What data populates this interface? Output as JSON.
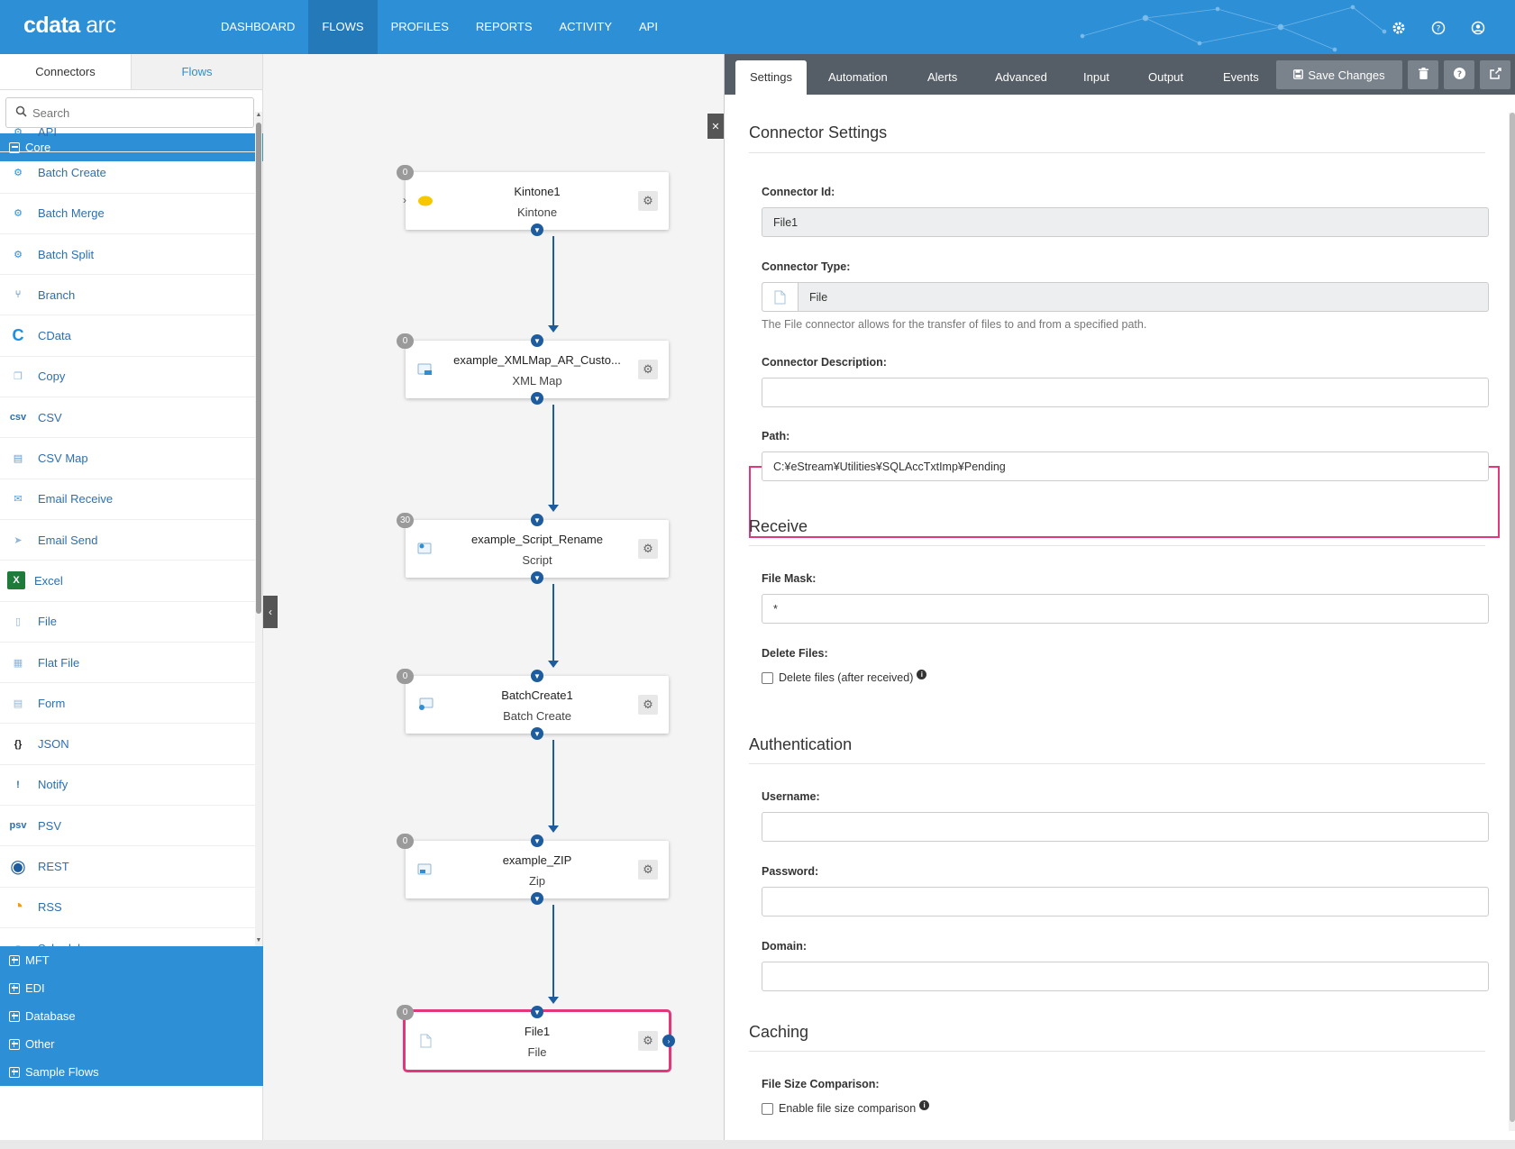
{
  "app": {
    "logo_brand": "cdata",
    "logo_product": "arc"
  },
  "nav": {
    "items": [
      {
        "label": "DASHBOARD",
        "active": false
      },
      {
        "label": "FLOWS",
        "active": true
      },
      {
        "label": "PROFILES",
        "active": false
      },
      {
        "label": "REPORTS",
        "active": false
      },
      {
        "label": "ACTIVITY",
        "active": false
      },
      {
        "label": "API",
        "active": false
      }
    ],
    "icons": [
      "gear-icon",
      "help-icon",
      "user-icon"
    ]
  },
  "left": {
    "tabs": [
      "Connectors",
      "Flows"
    ],
    "search_placeholder": "Search",
    "core_group": "Core",
    "connectors": [
      {
        "label": "API",
        "icon": "api-icon"
      },
      {
        "label": "Batch Create",
        "icon": "batch-create-icon"
      },
      {
        "label": "Batch Merge",
        "icon": "batch-merge-icon"
      },
      {
        "label": "Batch Split",
        "icon": "batch-split-icon"
      },
      {
        "label": "Branch",
        "icon": "branch-icon"
      },
      {
        "label": "CData",
        "icon": "cdata-icon"
      },
      {
        "label": "Copy",
        "icon": "copy-icon"
      },
      {
        "label": "CSV",
        "icon": "csv-icon"
      },
      {
        "label": "CSV Map",
        "icon": "csv-map-icon"
      },
      {
        "label": "Email Receive",
        "icon": "email-receive-icon"
      },
      {
        "label": "Email Send",
        "icon": "email-send-icon"
      },
      {
        "label": "Excel",
        "icon": "excel-icon"
      },
      {
        "label": "File",
        "icon": "file-icon"
      },
      {
        "label": "Flat File",
        "icon": "flat-file-icon"
      },
      {
        "label": "Form",
        "icon": "form-icon"
      },
      {
        "label": "JSON",
        "icon": "json-icon"
      },
      {
        "label": "Notify",
        "icon": "notify-icon"
      },
      {
        "label": "PSV",
        "icon": "psv-icon"
      },
      {
        "label": "REST",
        "icon": "rest-icon"
      },
      {
        "label": "RSS",
        "icon": "rss-icon"
      },
      {
        "label": "Schedule",
        "icon": "schedule-icon"
      }
    ],
    "groups": [
      "MFT",
      "EDI",
      "Database",
      "Other",
      "Sample Flows"
    ]
  },
  "flow": {
    "nodes": [
      {
        "title": "Kintone1",
        "type": "Kintone",
        "badge": "0",
        "icon": "kintone-icon"
      },
      {
        "title": "example_XMLMap_AR_Custo...",
        "type": "XML Map",
        "badge": "0",
        "icon": "xml-map-icon"
      },
      {
        "title": "example_Script_Rename",
        "type": "Script",
        "badge": "30",
        "icon": "script-icon"
      },
      {
        "title": "BatchCreate1",
        "type": "Batch Create",
        "badge": "0",
        "icon": "batch-create-icon"
      },
      {
        "title": "example_ZIP",
        "type": "Zip",
        "badge": "0",
        "icon": "zip-icon"
      },
      {
        "title": "File1",
        "type": "File",
        "badge": "0",
        "icon": "file-icon"
      }
    ]
  },
  "right": {
    "tabs": [
      "Settings",
      "Automation",
      "Alerts",
      "Advanced",
      "Input",
      "Output",
      "Events"
    ],
    "save_label": "Save Changes",
    "sections": {
      "connector_settings": "Connector Settings",
      "receive": "Receive",
      "authentication": "Authentication",
      "caching": "Caching"
    },
    "fields": {
      "connector_id_label": "Connector Id:",
      "connector_id_value": "File1",
      "connector_type_label": "Connector Type:",
      "connector_type_value": "File",
      "connector_type_help": "The File connector allows for the transfer of files to and from a specified path.",
      "description_label": "Connector Description:",
      "description_value": "",
      "path_label": "Path:",
      "path_value": "C:¥eStream¥Utilities¥SQLAccTxtImp¥Pending",
      "file_mask_label": "File Mask:",
      "file_mask_value": "*",
      "delete_files_label": "Delete Files:",
      "delete_files_check": "Delete files (after received)",
      "username_label": "Username:",
      "password_label": "Password:",
      "domain_label": "Domain:",
      "file_size_label": "File Size Comparison:",
      "file_size_check": "Enable file size comparison"
    }
  }
}
